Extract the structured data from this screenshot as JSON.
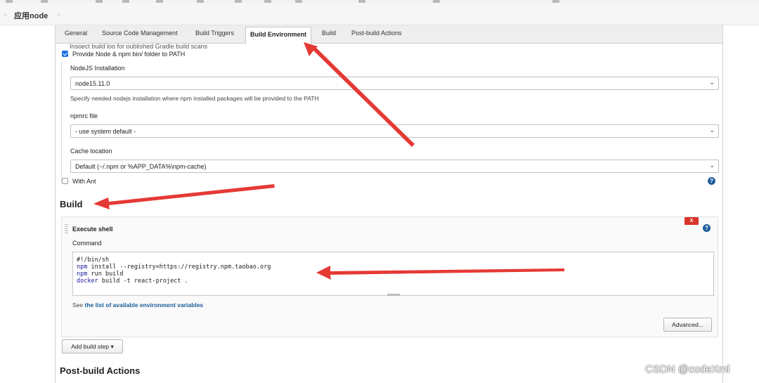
{
  "breadcrumb": {
    "label": "应用node"
  },
  "tabs": [
    {
      "label": "General"
    },
    {
      "label": "Source Code Management"
    },
    {
      "label": "Build Triggers"
    },
    {
      "label": "Build Environment",
      "active": true
    },
    {
      "label": "Build"
    },
    {
      "label": "Post-build Actions"
    }
  ],
  "build_environment": {
    "cut_off_option": "Inspect build log for published Gradle build scans",
    "provide_node": {
      "label": "Provide Node & npm bin/ folder to PATH",
      "checked": true
    },
    "nodejs_installation": {
      "label": "NodeJS Installation",
      "value": "node15.11.0",
      "hint": "Specify needed nodejs installation where npm installed packages will be provided to the PATH"
    },
    "npmrc_file": {
      "label": "npmrc file",
      "value": "- use system default -"
    },
    "cache_location": {
      "label": "Cache location",
      "value": "Default (~/.npm or %APP_DATA%\\npm-cache)"
    },
    "with_ant": {
      "label": "With Ant",
      "checked": false
    }
  },
  "build": {
    "title": "Build",
    "step": {
      "title": "Execute shell",
      "delete_label": "X",
      "command_label": "Command",
      "command_lines": [
        "#!/bin/sh",
        "",
        "npm install --registry=https://registry.npm.taobao.org",
        "npm run build",
        "docker build -t react-project ."
      ],
      "see_prefix": "See",
      "see_link": "the list of available environment variables",
      "advanced_label": "Advanced..."
    },
    "add_step_label": "Add build step"
  },
  "post_build": {
    "title": "Post-build Actions"
  },
  "help_label": "?",
  "watermark": "CSDN @codeXml",
  "colors": {
    "annotation_arrow": "#e53935",
    "link": "#1a5d99",
    "active_tab_bg": "#ffffff"
  }
}
